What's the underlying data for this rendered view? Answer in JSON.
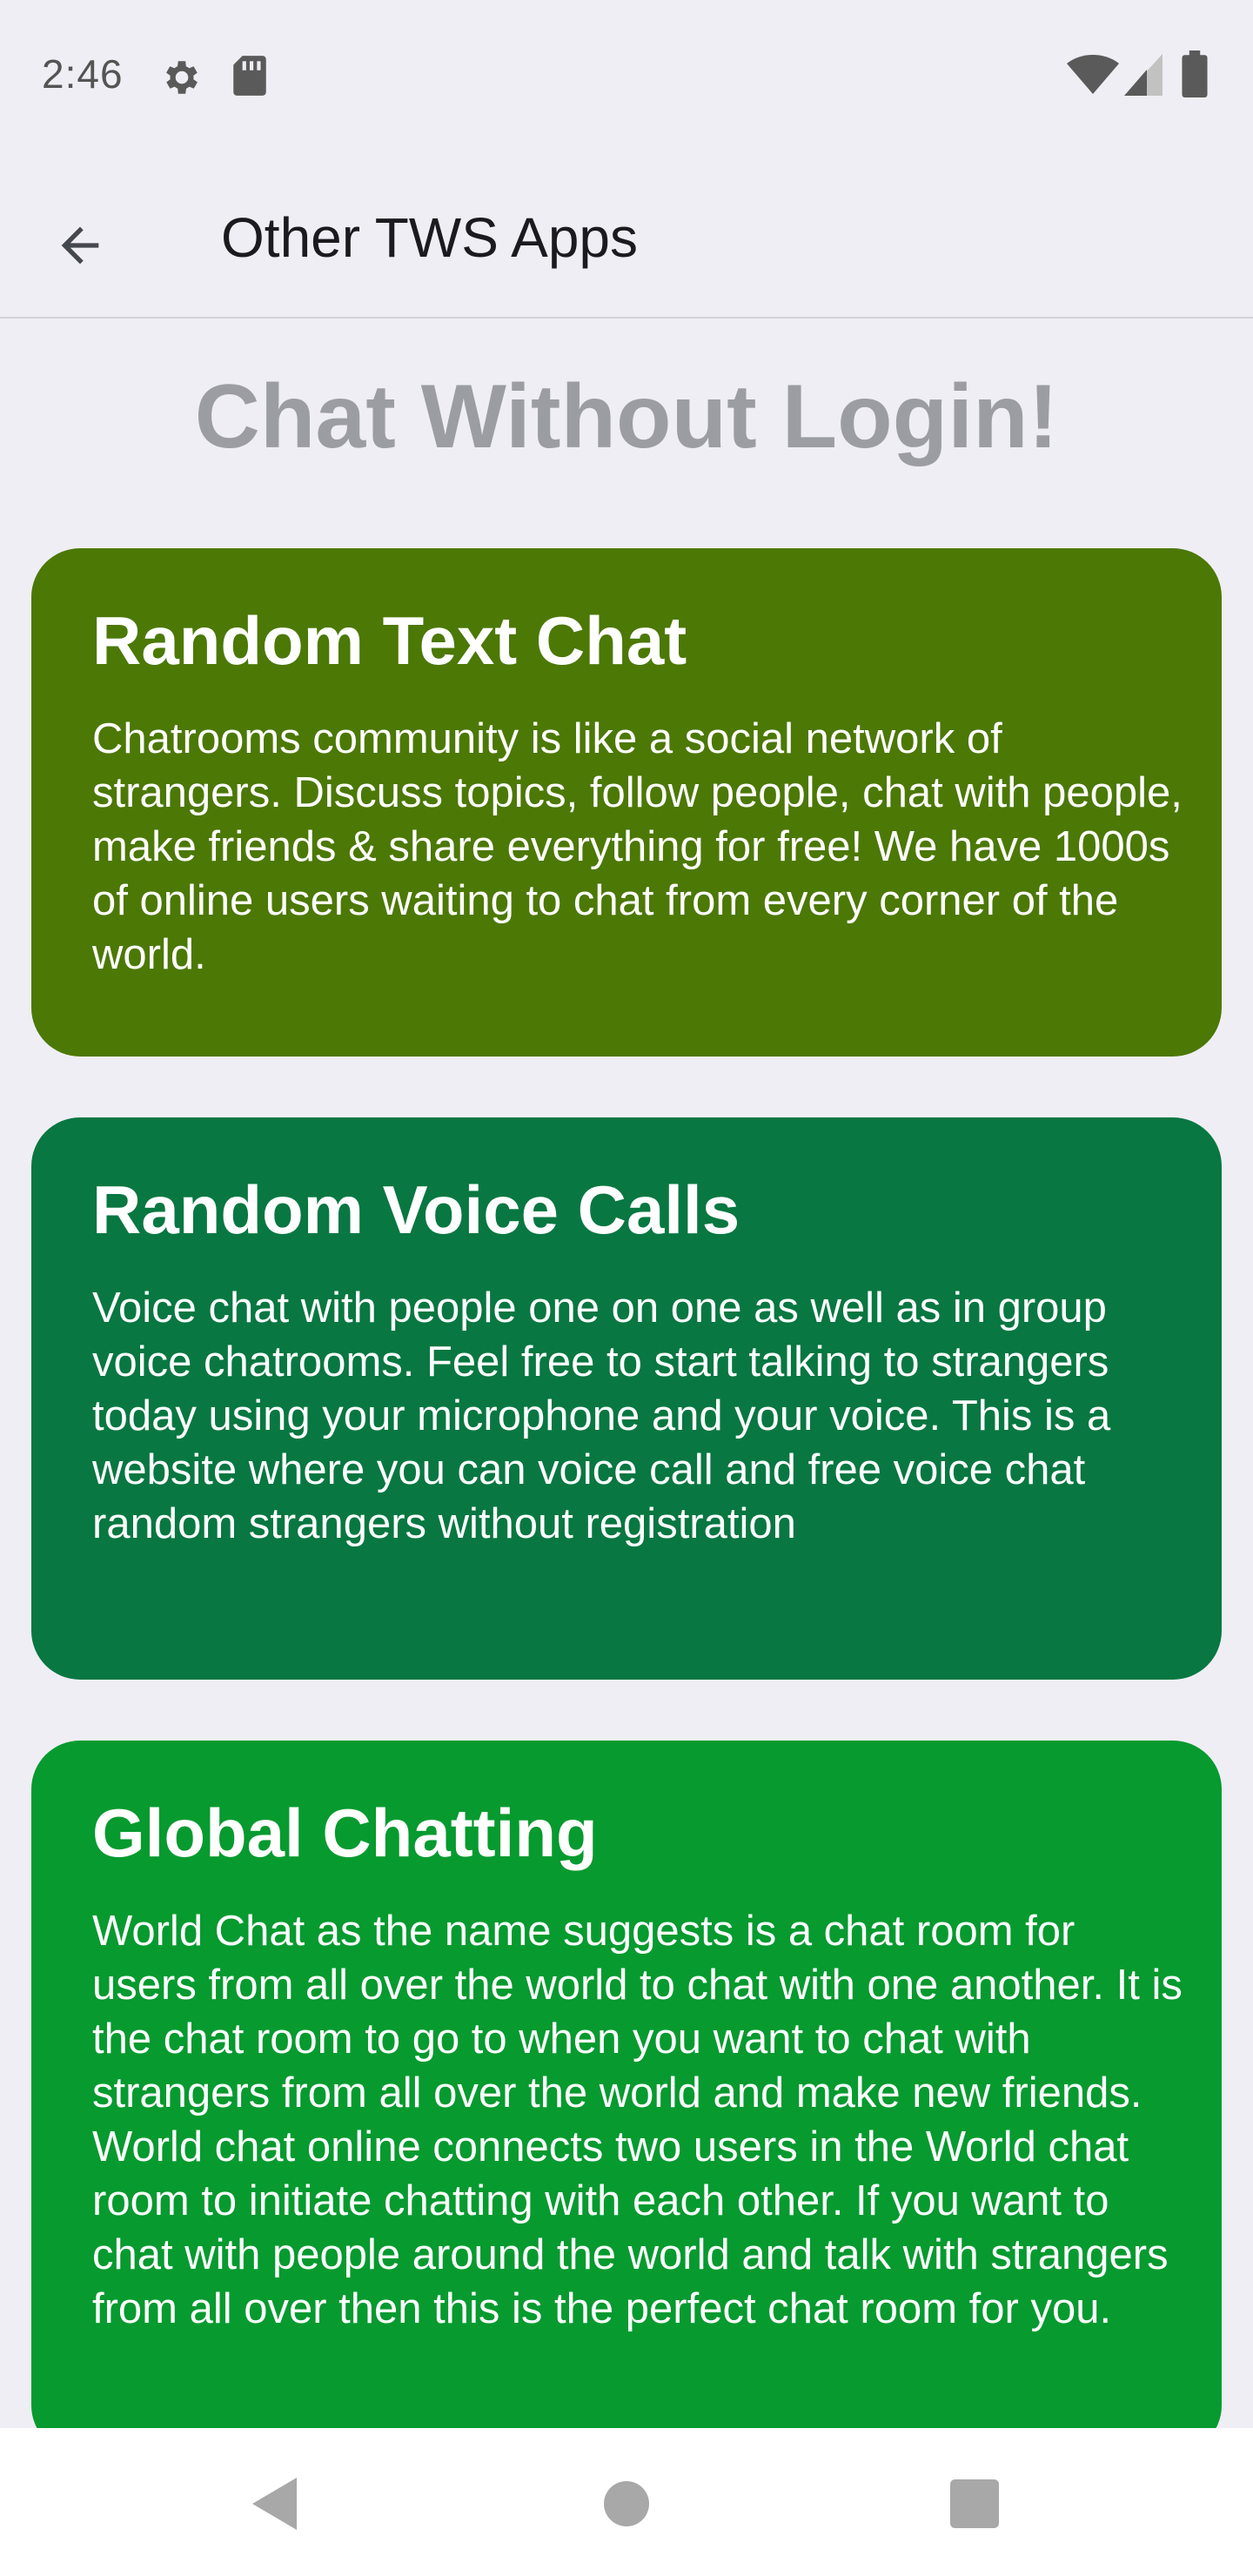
{
  "status_bar": {
    "time": "2:46",
    "icons": [
      "gear-icon",
      "sd-card-icon",
      "wifi-icon",
      "signal-icon",
      "battery-icon"
    ]
  },
  "app_bar": {
    "title": "Other TWS Apps",
    "back_icon": "arrow-left-icon"
  },
  "headline": "Chat Without Login!",
  "cards": [
    {
      "title": "Random Text Chat",
      "description": "Chatrooms community is like a social network of strangers. Discuss topics, follow people, chat with people, make friends & share everything for free! We have 1000s of online users waiting to chat from every corner of the world.",
      "color": "#4c7806"
    },
    {
      "title": "Random Voice Calls",
      "description": "Voice chat with people one on one as well as in group voice chatrooms. Feel free to start talking to strangers today using your microphone and your voice. This is a website where you can voice call and free voice chat random strangers without registration",
      "color": "#087741"
    },
    {
      "title": "Global Chatting",
      "description": "World Chat as the name suggests is a chat room for users from all over the world to chat with one another. It is the chat room to go to when you want to chat with strangers from all over the world and make new friends. World chat online connects two users in the World chat room to initiate chatting with each other. If you want to chat with people around the world and talk with strangers from all over then this is the perfect chat room for you.",
      "color": "#069a2f"
    }
  ],
  "nav_bar": {
    "icons": [
      "nav-back-icon",
      "nav-home-icon",
      "nav-recents-icon"
    ]
  },
  "colors": {
    "background": "#efeef4",
    "headline": "#9c9da2",
    "title_text": "#1b1b1f"
  }
}
